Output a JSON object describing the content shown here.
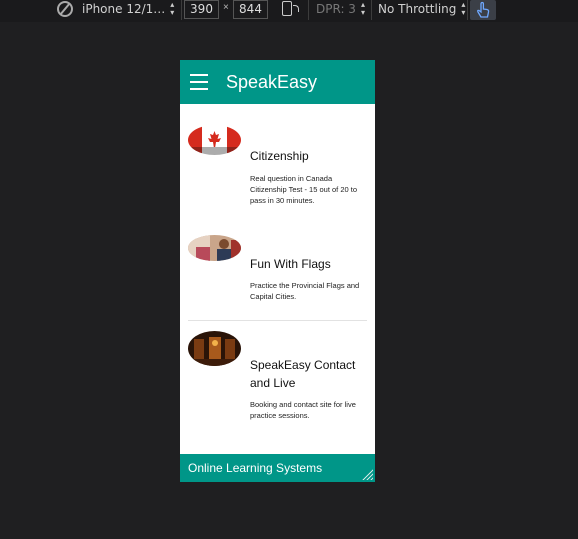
{
  "devtools": {
    "device": "iPhone 12/1…",
    "width": "390",
    "times": "×",
    "height": "844",
    "dpr": "DPR: 3",
    "throttling": "No Throttling"
  },
  "app": {
    "title": "SpeakEasy",
    "items": [
      {
        "title": "Citizenship",
        "description": "Real question in Canada Citizenship Test - 15 out of 20 to pass in 30 minutes."
      },
      {
        "title": "Fun With Flags",
        "description": "Practice the Provincial Flags and Capital Cities."
      },
      {
        "title": "SpeakEasy Contact and Live",
        "description": "Booking and contact site for live practice sessions."
      }
    ],
    "footer": "Online Learning Systems"
  },
  "colors": {
    "primary": "#009688",
    "background": "#1f1f21"
  }
}
